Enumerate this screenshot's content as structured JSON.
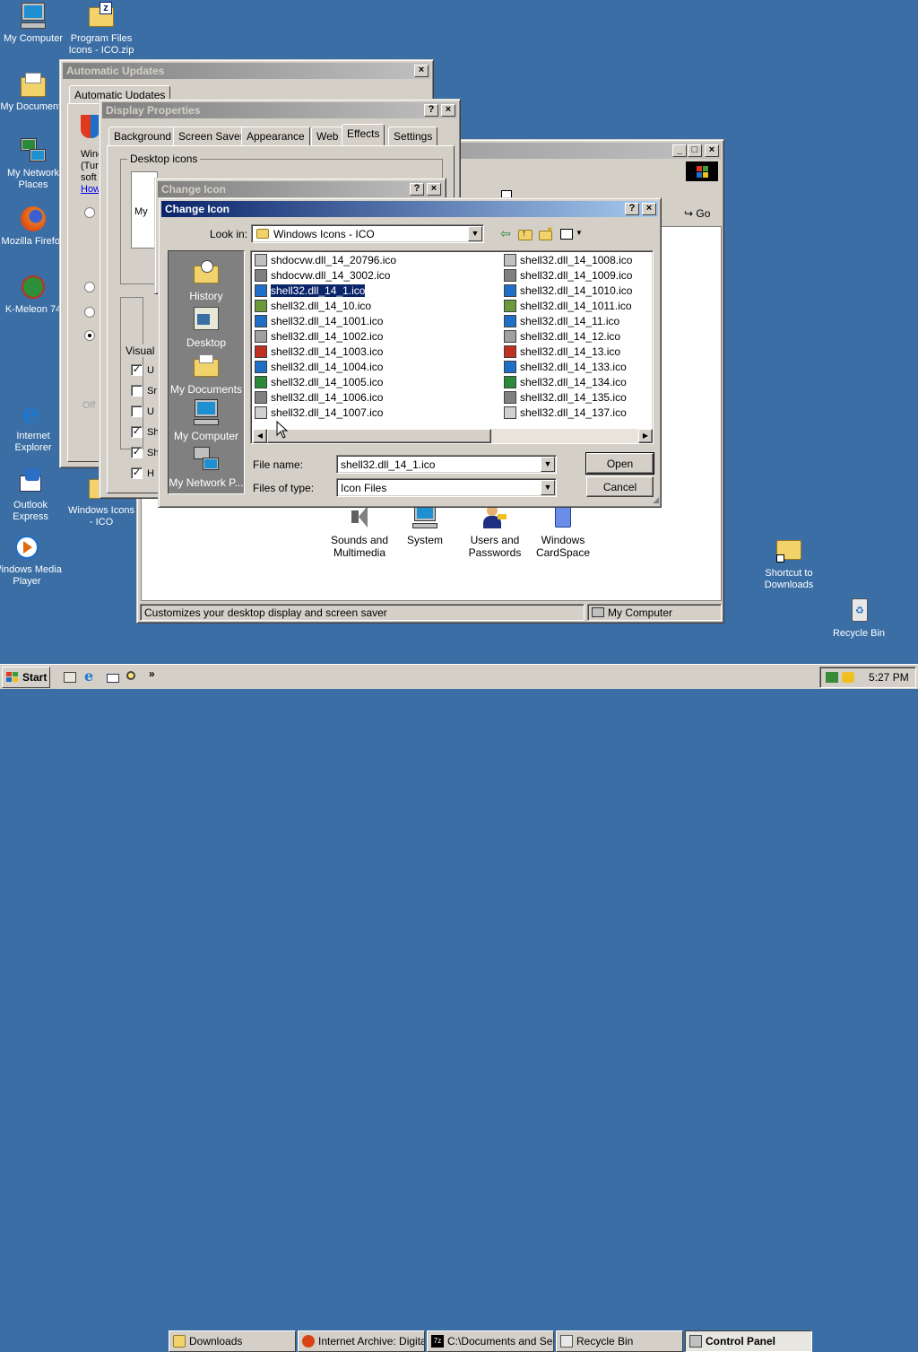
{
  "desktop": {
    "icons": [
      {
        "label": "My Computer"
      },
      {
        "label": "Program Files Icons - ICO.zip"
      },
      {
        "label": "My Documents"
      },
      {
        "label": "My Network Places"
      },
      {
        "label": "Mozilla Firefox"
      },
      {
        "label": "K-Meleon 74"
      },
      {
        "label": "Internet Explorer"
      },
      {
        "label": "Outlook Express"
      },
      {
        "label": "Windows Media Player"
      },
      {
        "label": "Windows Icons - ICO"
      },
      {
        "label": "Shortcut to Downloads"
      },
      {
        "label": "Recycle Bin"
      }
    ]
  },
  "auto_updates": {
    "title": "Automatic Updates",
    "tab": "Automatic Updates",
    "text_fragments": [
      "Wind",
      "(Tur",
      "soft",
      "How"
    ],
    "disabled_text": "Off"
  },
  "display_props": {
    "title": "Display Properties",
    "tabs": [
      "Background",
      "Screen Saver",
      "Appearance",
      "Web",
      "Effects",
      "Settings"
    ],
    "desktop_icons_label": "Desktop icons",
    "my_label": "My",
    "visual_label": "Visual",
    "check_letters": [
      "U",
      "Sr",
      "U",
      "Sh",
      "Sh",
      "H"
    ]
  },
  "control_panel": {
    "items": [
      {
        "label": "Sounds and Multimedia"
      },
      {
        "label": "System"
      },
      {
        "label": "Users and Passwords"
      },
      {
        "label": "Windows CardSpace"
      }
    ],
    "go_label": "Go",
    "status_left": "Customizes your desktop display and screen saver",
    "status_right": "My Computer"
  },
  "change_icon_bg": {
    "title": "Change Icon"
  },
  "change_icon": {
    "title": "Change Icon",
    "look_in_label": "Look in:",
    "look_in_value": "Windows Icons - ICO",
    "places": [
      "History",
      "Desktop",
      "My Documents",
      "My Computer",
      "My Network P..."
    ],
    "files_col1": [
      "shdocvw.dll_14_20796.ico",
      "shdocvw.dll_14_3002.ico",
      "shell32.dll_14_1.ico",
      "shell32.dll_14_10.ico",
      "shell32.dll_14_1001.ico",
      "shell32.dll_14_1002.ico",
      "shell32.dll_14_1003.ico",
      "shell32.dll_14_1004.ico",
      "shell32.dll_14_1005.ico",
      "shell32.dll_14_1006.ico",
      "shell32.dll_14_1007.ico"
    ],
    "files_col2": [
      "shell32.dll_14_1008.ico",
      "shell32.dll_14_1009.ico",
      "shell32.dll_14_1010.ico",
      "shell32.dll_14_1011.ico",
      "shell32.dll_14_11.ico",
      "shell32.dll_14_12.ico",
      "shell32.dll_14_13.ico",
      "shell32.dll_14_133.ico",
      "shell32.dll_14_134.ico",
      "shell32.dll_14_135.ico",
      "shell32.dll_14_137.ico"
    ],
    "selected_file": "shell32.dll_14_1.ico",
    "file_name_label": "File name:",
    "file_name_value": "shell32.dll_14_1.ico",
    "files_of_type_label": "Files of type:",
    "files_of_type_value": "Icon Files",
    "open_label": "Open",
    "cancel_label": "Cancel"
  },
  "taskbar": {
    "start_label": "Start",
    "tasks": [
      {
        "label": "Downloads"
      },
      {
        "label": "Internet Archive: Digita..."
      },
      {
        "label": "C:\\Documents and Se..."
      },
      {
        "label": "Recycle Bin"
      },
      {
        "label": "Control Panel"
      }
    ],
    "clock": "5:27 PM"
  },
  "colors": {
    "desktop": "#3a6ea5",
    "active_title": "#0a246a",
    "selection": "#0a246a",
    "face": "#d4d0c8"
  }
}
